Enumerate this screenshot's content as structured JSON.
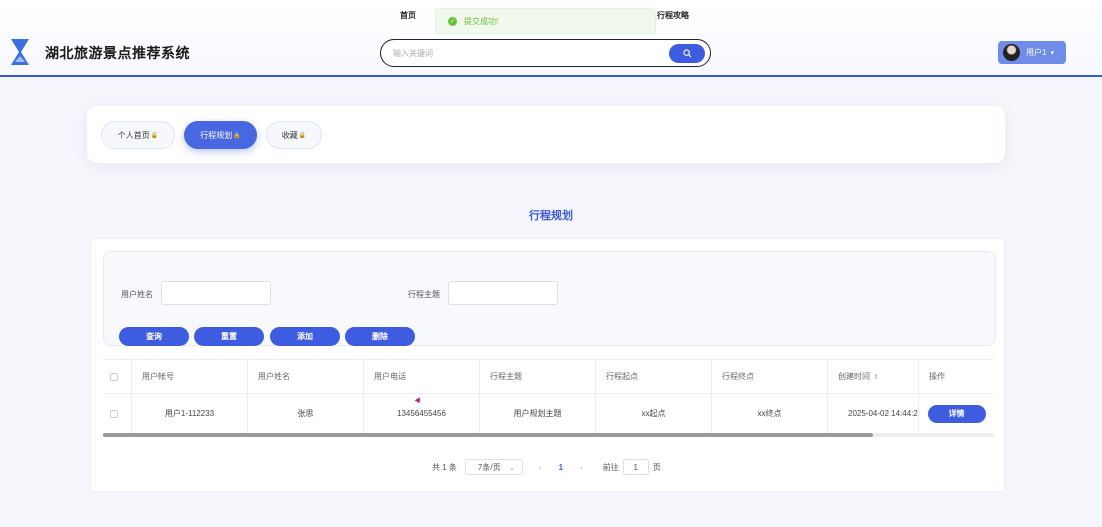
{
  "header": {
    "brand": "湖北旅游景点推荐系统",
    "nav": [
      "首页",
      "行程攻略"
    ],
    "search_placeholder": "输入关键词",
    "user": "用户1",
    "toast": "提交成功!"
  },
  "tabs": [
    {
      "label": "个人首页"
    },
    {
      "label": "行程规划"
    },
    {
      "label": "收藏"
    }
  ],
  "page_title": "行程规划",
  "form": {
    "fields": [
      {
        "label": "用户姓名",
        "value": ""
      },
      {
        "label": "行程主题",
        "value": ""
      }
    ],
    "buttons": [
      "查询",
      "重置",
      "添加",
      "删除"
    ]
  },
  "table": {
    "headers": [
      "用户帐号",
      "用户姓名",
      "用户电话",
      "行程主题",
      "行程起点",
      "行程终点",
      "创建时间",
      "操作"
    ],
    "rows": [
      [
        "用户1-112233",
        "张思",
        "13456455456",
        "用户规划主题",
        "xx起点",
        "xx终点",
        "2025-04-02 14:44:2",
        "详情"
      ]
    ]
  },
  "pagination": {
    "total": "共 1 条",
    "page_size": "7条/页",
    "current": "1",
    "goto_label": "前往",
    "goto_value": "1",
    "page_unit": "页"
  },
  "colors": {
    "accent": "#3d5ce0"
  }
}
